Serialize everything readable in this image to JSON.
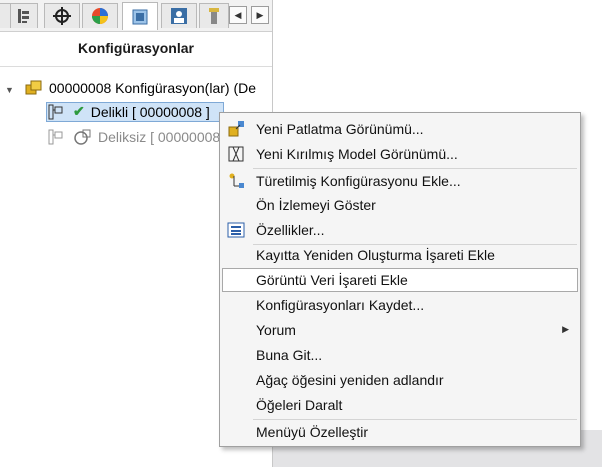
{
  "panel": {
    "title": "Konfigürasyonlar",
    "tree": {
      "root_label": "00000008 Konfigürasyon(lar)  (De",
      "item1_label": "Delikli [ 00000008 ]",
      "item2_label": "Deliksiz [ 00000008"
    },
    "tabs": [
      "feature-manager-icon",
      "property-manager-icon",
      "dimxpert-icon",
      "appearance-icon",
      "display-manager-icon",
      "tree-icon",
      "more-tab-icon"
    ],
    "scroll_left": "◀",
    "scroll_right": "▶"
  },
  "menu": {
    "items": [
      {
        "label": "Yeni Patlatma Görünümü...",
        "icon": "explode-view-icon"
      },
      {
        "label": "Yeni Kırılmış Model Görünümü...",
        "icon": "break-view-icon"
      },
      {
        "label": "Türetilmiş Konfigürasyonu Ekle...",
        "icon": "derived-config-icon"
      },
      {
        "label": "Ön İzlemeyi Göster",
        "icon": ""
      },
      {
        "label": "Özellikler...",
        "icon": "properties-icon"
      },
      {
        "label": "Kayıtta Yeniden Oluşturma İşareti Ekle",
        "icon": ""
      },
      {
        "label": "Görüntü Veri İşareti Ekle",
        "icon": ""
      },
      {
        "label": "Konfigürasyonları Kaydet...",
        "icon": ""
      },
      {
        "label": "Yorum",
        "icon": ""
      },
      {
        "label": "Buna Git...",
        "icon": ""
      },
      {
        "label": "Ağaç öğesini yeniden adlandır",
        "icon": ""
      },
      {
        "label": "Öğeleri Daralt",
        "icon": ""
      },
      {
        "label": "Menüyü Özelleştir",
        "icon": ""
      }
    ],
    "submenu_arrow": "▶"
  },
  "colors": {
    "selection_bg": "#cfe3f7",
    "check_green": "#2e9a3e",
    "config_yellow": "#e0b020"
  }
}
